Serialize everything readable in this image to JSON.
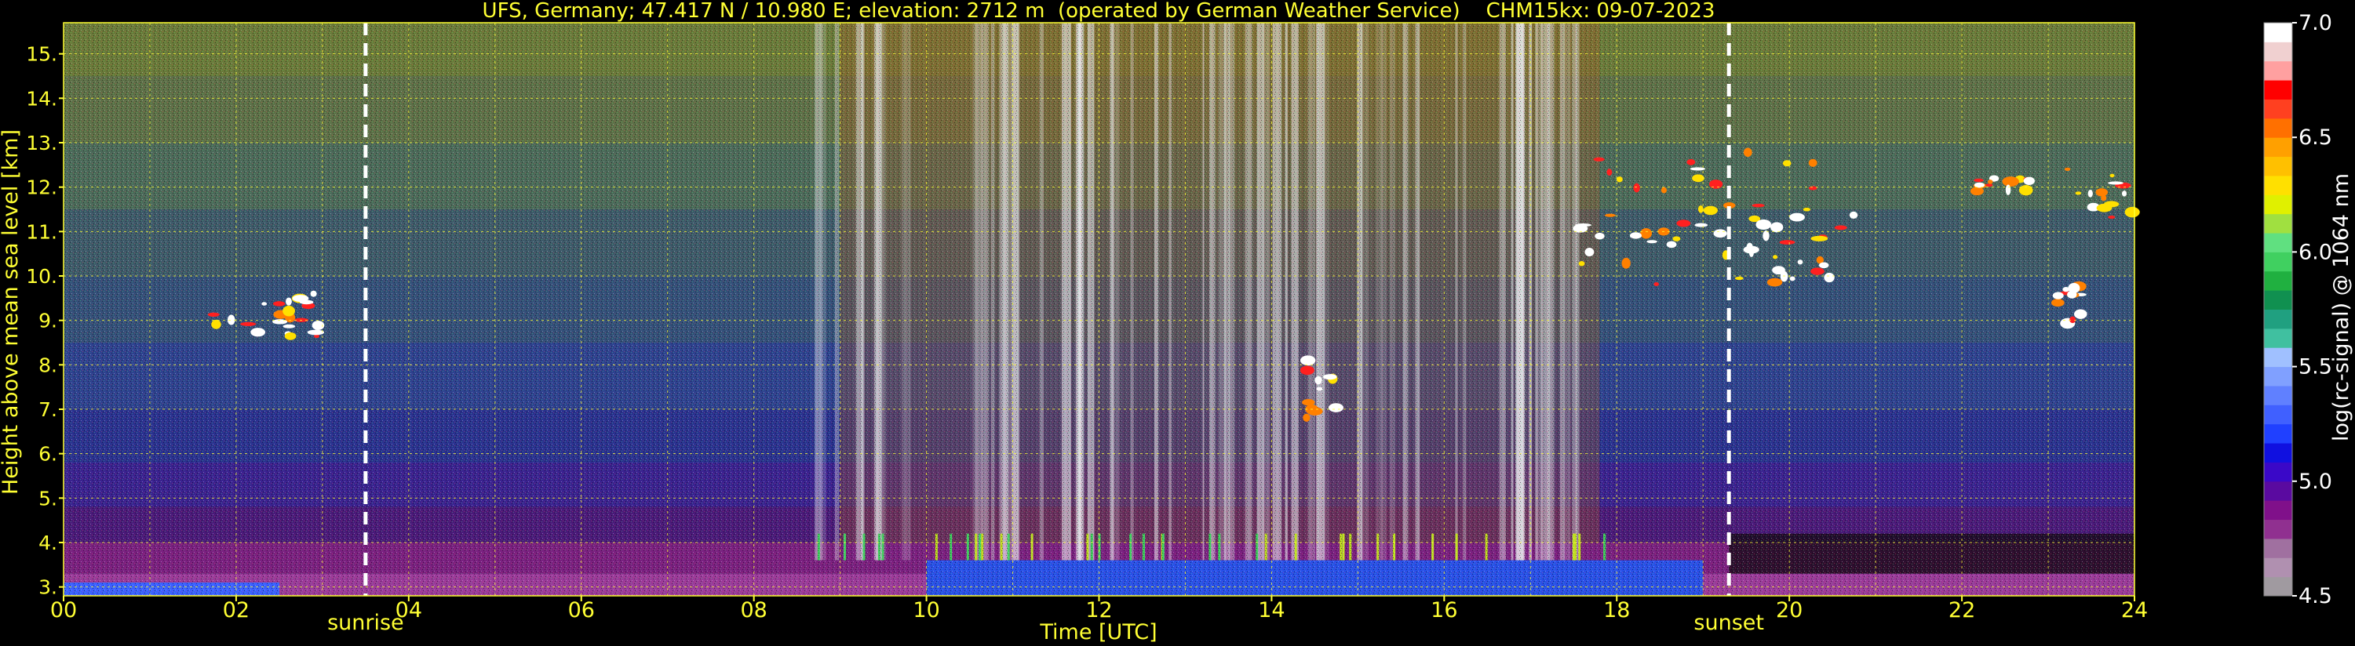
{
  "chart_data": {
    "type": "heatmap",
    "title": "UFS, Germany; 47.417 N / 10.980 E; elevation: 2712 m  (operated by German Weather Service)    CHM15kx: 09-07-2023",
    "xlabel": "Time [UTC]",
    "ylabel": "Height above mean sea level [km]",
    "xlim": [
      0,
      24
    ],
    "ylim": [
      2.8,
      15.7
    ],
    "x_ticks": [
      "00",
      "02",
      "04",
      "06",
      "08",
      "10",
      "12",
      "14",
      "16",
      "18",
      "20",
      "22",
      "24"
    ],
    "y_ticks": [
      "3.",
      "4.",
      "5.",
      "6.",
      "7.",
      "8.",
      "9.",
      "10.",
      "11.",
      "12.",
      "13.",
      "14.",
      "15."
    ],
    "grid": true,
    "colorbar": {
      "label": "log(rc-signal) @ 1064 nm",
      "range": [
        4.5,
        7.0
      ],
      "ticks": [
        "4.5",
        "5.0",
        "5.5",
        "6.0",
        "6.5",
        "7.0"
      ],
      "colors": [
        "#a09aa0",
        "#b090b0",
        "#a070a0",
        "#903090",
        "#80108a",
        "#5a0aa0",
        "#3a08c8",
        "#1010e0",
        "#2040ff",
        "#4060ff",
        "#6080ff",
        "#80a0ff",
        "#a0c0ff",
        "#40c0a0",
        "#20a080",
        "#109050",
        "#20b040",
        "#40d060",
        "#60e080",
        "#a0e040",
        "#e0f000",
        "#ffe000",
        "#ffc000",
        "#ffa000",
        "#ff7000",
        "#ff4020",
        "#ff0000",
        "#ffa0a0",
        "#f0d0d0",
        "#ffffff"
      ]
    },
    "events": [
      {
        "label": "sunrise",
        "time": 3.5
      },
      {
        "label": "sunset",
        "time": 19.3
      }
    ],
    "features": [
      {
        "kind": "noise_background",
        "x_range": [
          0,
          24
        ],
        "y_range": [
          2.8,
          15.7
        ]
      },
      {
        "kind": "boundary_layer",
        "x_range": [
          0,
          24
        ],
        "y_range": [
          2.8,
          4.0
        ]
      },
      {
        "kind": "cloud",
        "x_range": [
          1.7,
          3.0
        ],
        "y_range": [
          8.6,
          9.6
        ]
      },
      {
        "kind": "cloud",
        "x_range": [
          14.4,
          14.8
        ],
        "y_range": [
          6.8,
          8.1
        ]
      },
      {
        "kind": "cloud",
        "x_range": [
          17.5,
          20.8
        ],
        "y_range": [
          9.8,
          12.8
        ]
      },
      {
        "kind": "cloud",
        "x_range": [
          22.1,
          22.8
        ],
        "y_range": [
          11.8,
          12.2
        ]
      },
      {
        "kind": "cloud",
        "x_range": [
          23.2,
          24.0
        ],
        "y_range": [
          11.3,
          12.5
        ]
      },
      {
        "kind": "cloud",
        "x_range": [
          23.1,
          23.4
        ],
        "y_range": [
          8.9,
          9.8
        ]
      },
      {
        "kind": "precip_streaks",
        "x_range": [
          8.7,
          17.9
        ],
        "y_range": [
          3.5,
          15.7
        ]
      }
    ]
  }
}
